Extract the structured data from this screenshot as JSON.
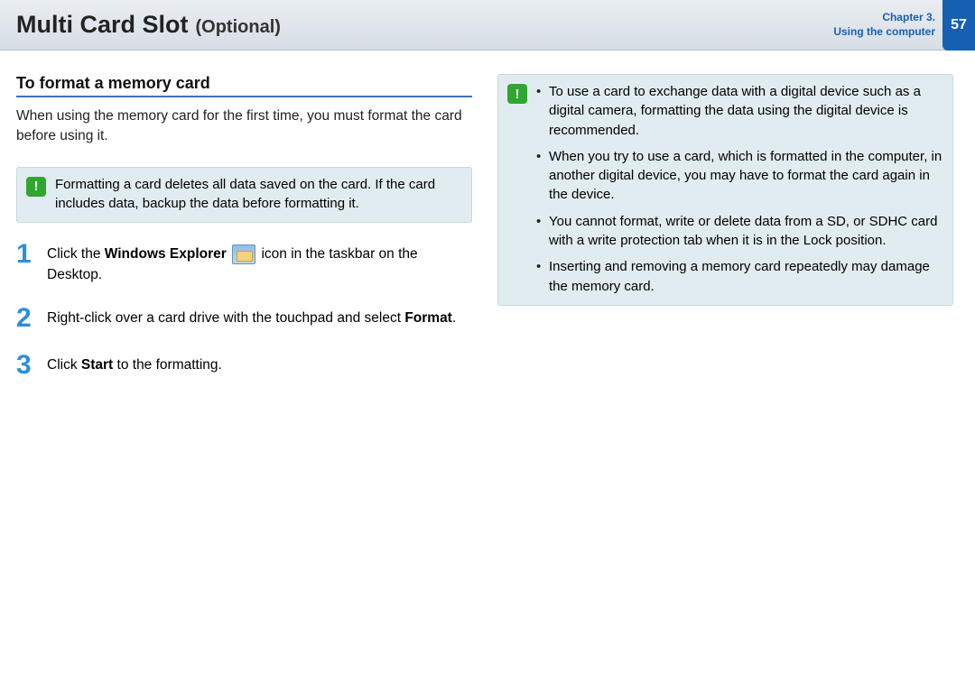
{
  "header": {
    "title_main": "Multi Card Slot",
    "title_note": "(Optional)",
    "chapter_line1": "Chapter 3.",
    "chapter_line2": "Using the computer",
    "page_number": "57"
  },
  "left": {
    "section_title": "To format a memory card",
    "intro": "When using the memory card for the first time, you must format the card before using it.",
    "warning": "Formatting a card deletes all data saved on the card. If the card includes data, backup the data before formatting it.",
    "steps": [
      {
        "num": "1",
        "pre": "Click the ",
        "bold1": "Windows Explorer",
        "post": " icon in the taskbar on the Desktop."
      },
      {
        "num": "2",
        "pre": "Right-click over a card drive with the touchpad and select ",
        "bold1": "Format",
        "post": "."
      },
      {
        "num": "3",
        "pre": "Click ",
        "bold1": "Start",
        "post": " to the formatting."
      }
    ]
  },
  "right": {
    "notes": [
      "To use a card to exchange data with a digital device such as a digital camera, formatting the data using the digital device is recommended.",
      "When you try to use a card, which is formatted in the computer, in another digital device, you may have to format the card again in the device.",
      "You cannot format, write or delete data from a SD, or SDHC card with a write protection tab when it is in the Lock position.",
      "Inserting and removing a memory card repeatedly may damage the memory card."
    ]
  }
}
